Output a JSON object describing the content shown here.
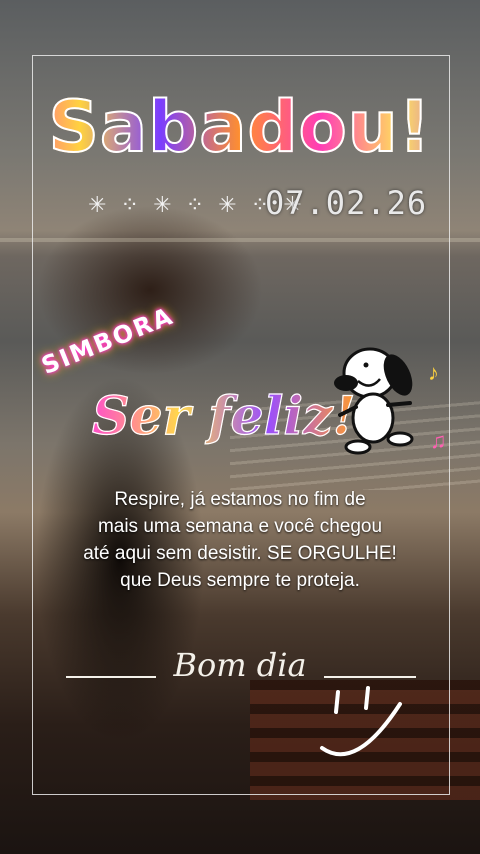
{
  "title": "Sabadou!",
  "date": "07.02.26",
  "stars": "✳ ⁘ ✳ ⁘ ✳ ⁘ ✳",
  "sticker": {
    "simbora": "SIMBORA",
    "ser_feliz": "Ser feliz!"
  },
  "message": [
    "Respire, já estamos no fim de",
    "mais uma semana e você chegou",
    "até aqui sem desistir. SE ORGULHE!",
    "que Deus sempre te proteja."
  ],
  "greeting": "Bom dia",
  "colors": {
    "frame": "#ebebeb",
    "neon": "#ff2fd6",
    "text": "#ffffff"
  },
  "icons": [
    "snowflake-icon",
    "snoopy-dancing-icon",
    "music-note-icon",
    "smiley-icon"
  ]
}
